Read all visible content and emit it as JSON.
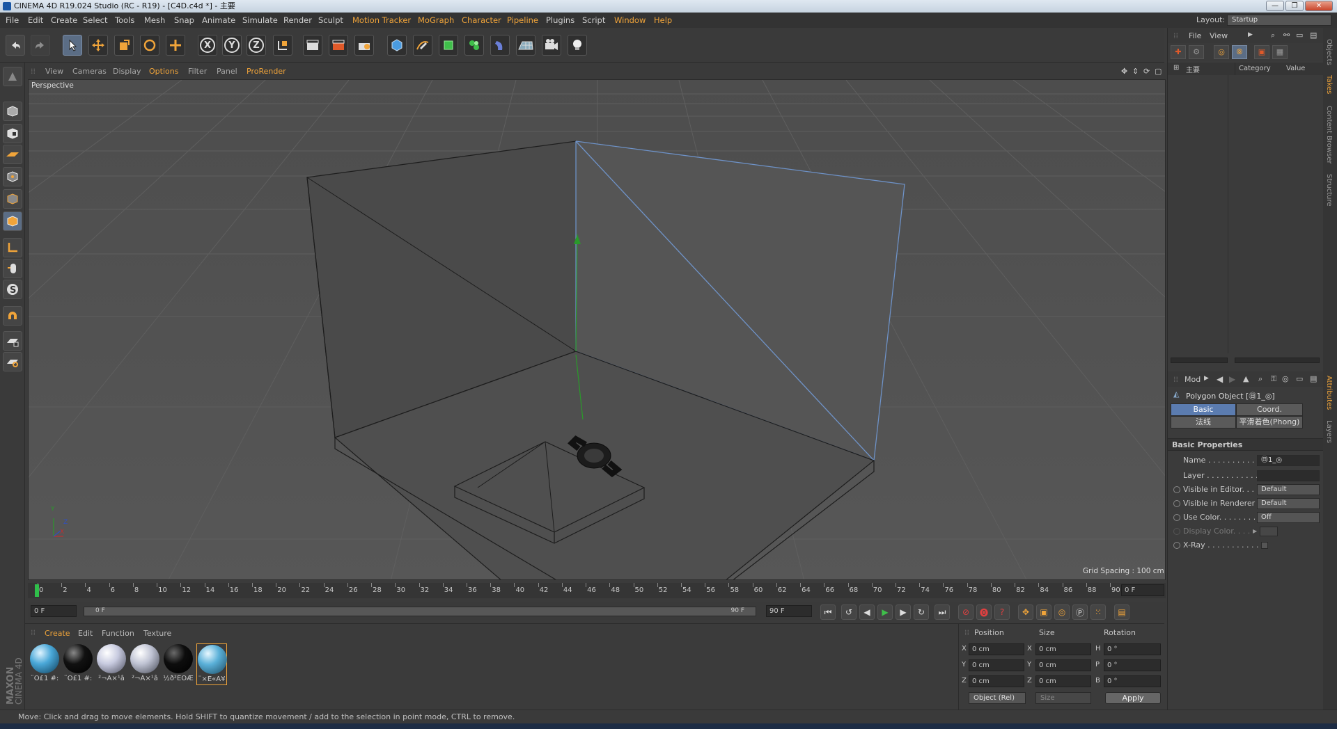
{
  "window": {
    "title": "CINEMA 4D R19.024 Studio (RC - R19) - [C4D.c4d *] - 主要",
    "layout_label": "Layout:",
    "layout_value": "Startup"
  },
  "menus": [
    "File",
    "Edit",
    "Create",
    "Select",
    "Tools",
    "Mesh",
    "Snap",
    "Animate",
    "Simulate",
    "Render",
    "Sculpt",
    "Motion Tracker",
    "MoGraph",
    "Character",
    "Pipeline",
    "Plugins",
    "Script",
    "Window",
    "Help"
  ],
  "toolbar": {
    "axis_labels": [
      "X",
      "Y",
      "Z"
    ]
  },
  "viewport": {
    "menu": [
      "View",
      "Cameras",
      "Display",
      "Options",
      "Filter",
      "Panel",
      "ProRender"
    ],
    "active_menu": "Options",
    "label": "Perspective",
    "grid_spacing": "Grid Spacing : 100 cm",
    "axis_labels": [
      "Y",
      "Z",
      "X"
    ]
  },
  "timeline": {
    "ticks": [
      "0",
      "2",
      "4",
      "6",
      "8",
      "10",
      "12",
      "14",
      "16",
      "18",
      "20",
      "22",
      "24",
      "26",
      "28",
      "30",
      "32",
      "34",
      "36",
      "38",
      "40",
      "42",
      "44",
      "46",
      "48",
      "50",
      "52",
      "54",
      "56",
      "58",
      "60",
      "62",
      "64",
      "66",
      "68",
      "70",
      "72",
      "74",
      "76",
      "78",
      "80",
      "82",
      "84",
      "86",
      "88",
      "90"
    ],
    "current_frame_field": "0 F",
    "start_field": "0 F",
    "range_start": "0 F",
    "range_end": "90 F",
    "end_field": "90 F"
  },
  "materials": {
    "menu": [
      "Create",
      "Edit",
      "Function",
      "Texture"
    ],
    "active_menu": "Create",
    "items": [
      {
        "label": "¨O£1 #:",
        "color": "#4aa8d8"
      },
      {
        "label": "¨O£1 #:",
        "color": "#111111"
      },
      {
        "label": "²¬Á×¹â",
        "color": "#c8cbe0"
      },
      {
        "label": "²¬Á×¹â",
        "color": "#c0c4d4"
      },
      {
        "label": "½ð²ÊÔÆ",
        "color": "#0d0d0d"
      },
      {
        "label": "¨×É«Ä¥",
        "color": "#5ab0d8"
      }
    ]
  },
  "coords": {
    "headers": [
      "Position",
      "Size",
      "Rotation"
    ],
    "rows": [
      {
        "axis1": "X",
        "pos": "0 cm",
        "axis2": "X",
        "size": "0 cm",
        "axis3": "H",
        "rot": "0 °"
      },
      {
        "axis1": "Y",
        "pos": "0 cm",
        "axis2": "Y",
        "size": "0 cm",
        "axis3": "P",
        "rot": "0 °"
      },
      {
        "axis1": "Z",
        "pos": "0 cm",
        "axis2": "Z",
        "size": "0 cm",
        "axis3": "B",
        "rot": "0 °"
      }
    ],
    "mode_select": "Object (Rel)",
    "size_select": "Size",
    "apply_label": "Apply"
  },
  "status": "Move: Click and drag to move elements. Hold SHIFT to quantize movement / add to the selection in point mode, CTRL to remove.",
  "objects_panel": {
    "menu": [
      "File",
      "View"
    ],
    "tree_item": "主要",
    "col_category": "Category",
    "col_value": "Value"
  },
  "attributes": {
    "mode_label": "Mod",
    "object_title": "Polygon Object [㊐1_◎]",
    "tabs": [
      "Basic",
      "Coord.",
      "法线",
      "平滑着色(Phong)"
    ],
    "active_tab": "Basic",
    "section": "Basic Properties",
    "props": [
      {
        "label": "Name . . . . . . . . . . . .",
        "value": "㊐1_◎"
      },
      {
        "label": "Layer . . . . . . . . . . . .",
        "value": ""
      },
      {
        "label": "Visible in Editor. . .",
        "value": "Default"
      },
      {
        "label": "Visible in Renderer",
        "value": "Default"
      },
      {
        "label": "Use Color. . . . . . . .",
        "value": "Off"
      },
      {
        "label": "Display Color. . . .",
        "value": ""
      },
      {
        "label": "X-Ray . . . . . . . . . . .",
        "value": ""
      }
    ]
  },
  "side_tabs": [
    "Objects",
    "Takes",
    "Content Browser",
    "Structure",
    "Attributes",
    "Layers"
  ]
}
